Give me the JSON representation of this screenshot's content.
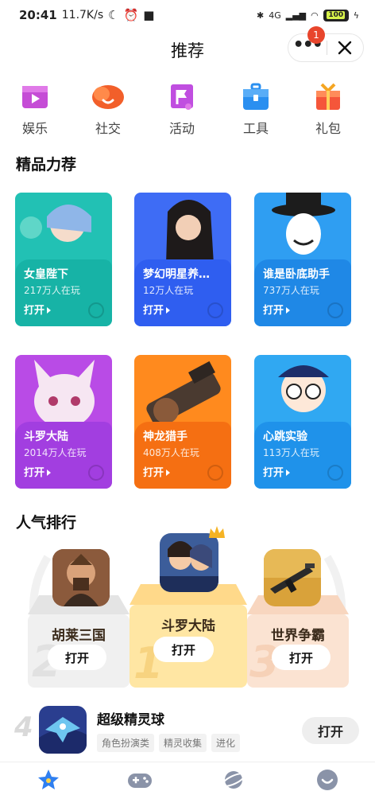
{
  "status_bar": {
    "time": "20:41",
    "speed": "11.7K/s",
    "network": "4G",
    "battery": "100"
  },
  "header": {
    "title": "推荐",
    "badge_count": "1"
  },
  "categories": [
    {
      "label": "娱乐",
      "icon": "play-icon",
      "color": "#c54cd6"
    },
    {
      "label": "社交",
      "icon": "chat-icon",
      "color": "#f25f2a"
    },
    {
      "label": "活动",
      "icon": "flag-icon",
      "color": "#c04ee0"
    },
    {
      "label": "工具",
      "icon": "toolbox-icon",
      "color": "#2a8ff0"
    },
    {
      "label": "礼包",
      "icon": "gift-icon",
      "color": "#f5563a"
    }
  ],
  "featured": {
    "title": "精品力荐",
    "open_label": "打开",
    "cards": [
      {
        "name": "女皇陛下",
        "players": "217万人在玩",
        "color": "#22c1b4",
        "panel": "#17b3a6"
      },
      {
        "name": "梦幻明星养…",
        "players": "12万人在玩",
        "color": "#3e6cf5",
        "panel": "#2f5ef0"
      },
      {
        "name": "谁是卧底助手",
        "players": "737万人在玩",
        "color": "#2f9ef2",
        "panel": "#1f88e6"
      },
      {
        "name": "斗罗大陆",
        "players": "2014万人在玩",
        "color": "#b94be6",
        "panel": "#a23ee0"
      },
      {
        "name": "神龙猎手",
        "players": "408万人在玩",
        "color": "#ff8a1e",
        "panel": "#f56f12"
      },
      {
        "name": "心跳实验",
        "players": "113万人在玩",
        "color": "#30a8f2",
        "panel": "#1f92ea"
      }
    ]
  },
  "ranking": {
    "title": "人气排行",
    "open_label": "打开",
    "podium": [
      {
        "rank": "2",
        "name": "胡莱三国"
      },
      {
        "rank": "1",
        "name": "斗罗大陆"
      },
      {
        "rank": "3",
        "name": "世界争霸"
      }
    ],
    "list": [
      {
        "rank": "4",
        "name": "超级精灵球",
        "tags": [
          "角色扮演类",
          "精灵收集",
          "进化"
        ],
        "open_label": "打开"
      }
    ]
  },
  "bottom_nav": [
    "star-icon",
    "gamepad-icon",
    "planet-icon",
    "smile-icon"
  ]
}
